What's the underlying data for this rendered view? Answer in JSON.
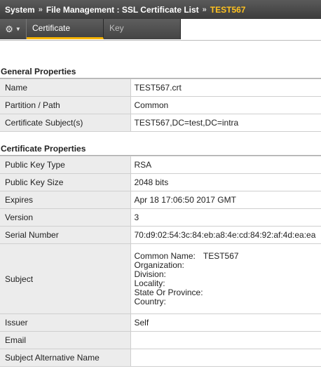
{
  "breadcrumb": {
    "items": [
      "System",
      "File Management : SSL Certificate List"
    ],
    "separator": "»",
    "current": "TEST567"
  },
  "tabs": {
    "gear_icon": "gear-icon",
    "certificate": "Certificate",
    "key": "Key"
  },
  "general": {
    "title": "General Properties",
    "rows": [
      {
        "label": "Name",
        "value": "TEST567.crt"
      },
      {
        "label": "Partition / Path",
        "value": "Common"
      },
      {
        "label": "Certificate Subject(s)",
        "value": "TEST567,DC=test,DC=intra"
      }
    ]
  },
  "certificate": {
    "title": "Certificate Properties",
    "public_key_type": {
      "label": "Public Key Type",
      "value": "RSA"
    },
    "public_key_size": {
      "label": "Public Key Size",
      "value": "2048 bits"
    },
    "expires": {
      "label": "Expires",
      "value": "Apr 18 17:06:50 2017 GMT"
    },
    "version": {
      "label": "Version",
      "value": "3"
    },
    "serial_number": {
      "label": "Serial Number",
      "value": "70:d9:02:54:3c:84:eb:a8:4e:cd:84:92:af:4d:ea:ea"
    },
    "subject": {
      "label": "Subject",
      "common_name_label": "Common Name:",
      "common_name_value": "TEST567",
      "organization_label": "Organization:",
      "division_label": "Division:",
      "locality_label": "Locality:",
      "state_label": "State Or Province:",
      "country_label": "Country:"
    },
    "issuer": {
      "label": "Issuer",
      "value": "Self"
    },
    "email": {
      "label": "Email",
      "value": ""
    },
    "san": {
      "label": "Subject Alternative Name",
      "value": ""
    }
  },
  "colors": {
    "header_bg": "#444444",
    "accent": "#f7b500",
    "current_crumb": "#ffc220",
    "label_bg": "#ececec"
  }
}
